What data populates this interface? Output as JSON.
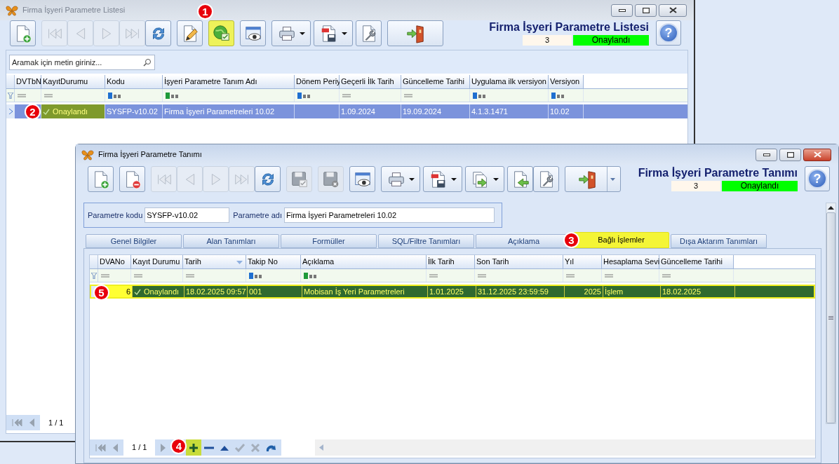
{
  "list_window": {
    "title": "Firma İşyeri Parametre Listesi",
    "toolbar": [
      {
        "kind": "new",
        "disabled": false,
        "highlighted": false
      },
      {
        "kind": "first",
        "disabled": true,
        "highlighted": false
      },
      {
        "kind": "prev",
        "disabled": true,
        "highlighted": false
      },
      {
        "kind": "next",
        "disabled": true,
        "highlighted": false
      },
      {
        "kind": "last",
        "disabled": true,
        "highlighted": false
      },
      {
        "kind": "refresh",
        "disabled": false,
        "highlighted": false
      },
      {
        "kind": "edit",
        "disabled": false,
        "highlighted": false
      },
      {
        "kind": "approve",
        "disabled": false,
        "highlighted": true,
        "marker": "1"
      },
      {
        "kind": "preview",
        "disabled": false,
        "highlighted": false
      },
      {
        "kind": "print",
        "disabled": false,
        "highlighted": false,
        "dropdown": true
      },
      {
        "kind": "pdf",
        "disabled": false,
        "highlighted": false,
        "dropdown": true
      },
      {
        "kind": "settings",
        "disabled": false,
        "highlighted": false
      },
      {
        "kind": "exit",
        "disabled": false,
        "highlighted": false
      }
    ],
    "header_title": "Firma İşyeri Parametre Listesi",
    "count": "3",
    "status": "Onaylandı",
    "help": "?",
    "search": {
      "placeholder": "Aramak için metin giriniz..."
    },
    "columns": [
      "DVTbN",
      "KayıtDurumu",
      "Kodu",
      "İşyeri Parametre Tanım Adı",
      "Dönem Periy",
      "Geçerli İlk Tarih",
      "Güncelleme Tarihi",
      "Uygulama ilk versiyon",
      "Versiyon"
    ],
    "filters": [
      {
        "kind": "eq"
      },
      {
        "kind": "eq"
      },
      {
        "kind": "abc"
      },
      {
        "kind": "abc_green"
      },
      {
        "kind": "abc"
      },
      {
        "kind": "eq"
      },
      {
        "kind": "eq"
      },
      {
        "kind": "abc"
      },
      {
        "kind": "abc"
      }
    ],
    "rows": [
      {
        "selected": true,
        "marker": "2",
        "cells": [
          null,
          {
            "text": "Onaylandı",
            "kind": "status",
            "highlighted": true
          },
          {
            "text": "SYSFP-v10.02"
          },
          {
            "text": "Firma İşyeri Parametreleri 10.02"
          },
          null,
          {
            "text": "1.09.2024"
          },
          {
            "text": "19.09.2024"
          },
          {
            "text": "4.1.3.1471"
          },
          {
            "text": "10.02"
          }
        ]
      }
    ],
    "pager": "1 / 1"
  },
  "detail_window": {
    "title": "Firma İşyeri Parametre Tanımı",
    "toolbar": [
      {
        "kind": "new",
        "disabled": false,
        "highlighted": false
      },
      {
        "kind": "delete",
        "disabled": false,
        "highlighted": false
      },
      {
        "kind": "first",
        "disabled": true,
        "highlighted": false
      },
      {
        "kind": "prev",
        "disabled": true,
        "highlighted": false
      },
      {
        "kind": "next",
        "disabled": true,
        "highlighted": false
      },
      {
        "kind": "last",
        "disabled": true,
        "highlighted": false
      },
      {
        "kind": "refresh",
        "disabled": false,
        "highlighted": false
      },
      {
        "kind": "save",
        "disabled": true,
        "highlighted": false
      },
      {
        "kind": "cancel_save",
        "disabled": true,
        "highlighted": false
      },
      {
        "kind": "preview",
        "disabled": false,
        "highlighted": false
      },
      {
        "kind": "print",
        "disabled": false,
        "highlighted": false,
        "dropdown": true
      },
      {
        "kind": "pdf",
        "disabled": false,
        "highlighted": false,
        "dropdown": true
      },
      {
        "kind": "export",
        "disabled": false,
        "highlighted": false,
        "dropdown": true
      },
      {
        "kind": "import",
        "disabled": false,
        "highlighted": false
      },
      {
        "kind": "settings",
        "disabled": false,
        "highlighted": false
      },
      {
        "kind": "exit",
        "disabled": false,
        "highlighted": false,
        "dropdown": true
      }
    ],
    "header_title": "Firma İşyeri Parametre Tanımı",
    "count": "3",
    "status": "Onaylandı",
    "help": "?",
    "fields": [
      {
        "label": "Parametre kodu",
        "value": "SYSFP-v10.02"
      },
      {
        "label": "Parametre adı",
        "value": "Firma İşyeri Parametreleri 10.02"
      }
    ],
    "tabs": [
      {
        "label": "Genel Bilgiler",
        "selected": false
      },
      {
        "label": "Alan Tanımları",
        "selected": false
      },
      {
        "label": "Formüller",
        "selected": false
      },
      {
        "label": "SQL/Filtre Tanımları",
        "selected": false
      },
      {
        "label": "Açıklama",
        "selected": false
      },
      {
        "label": "Bağlı İşlemler",
        "selected": true,
        "marker": "3"
      },
      {
        "label": "Dışa Aktarım Tanımları",
        "selected": false
      }
    ],
    "columns": [
      {
        "label": "DVANo",
        "sorted": false,
        "numeric": true
      },
      {
        "label": "Kayıt Durumu",
        "sorted": false,
        "numeric": false
      },
      {
        "label": "Tarih",
        "sorted": true,
        "numeric": false
      },
      {
        "label": "Takip No",
        "sorted": false,
        "numeric": false
      },
      {
        "label": "Açıklama",
        "sorted": false,
        "numeric": false
      },
      {
        "label": "İlk Tarih",
        "sorted": false,
        "numeric": false
      },
      {
        "label": "Son Tarih",
        "sorted": false,
        "numeric": false
      },
      {
        "label": "Yıl",
        "sorted": false,
        "numeric": true
      },
      {
        "label": "Hesaplama Sevi",
        "sorted": false,
        "numeric": false
      },
      {
        "label": "Güncelleme Tarihi",
        "sorted": false,
        "numeric": false
      }
    ],
    "filters": [
      {
        "kind": "eq"
      },
      {
        "kind": "eq"
      },
      {
        "kind": "eq"
      },
      {
        "kind": "abc"
      },
      {
        "kind": "abc_green"
      },
      {
        "kind": "eq"
      },
      {
        "kind": "eq"
      },
      {
        "kind": "eq"
      },
      {
        "kind": "eq"
      },
      {
        "kind": "eq"
      }
    ],
    "rows": [
      {
        "selected": true,
        "marker": "5",
        "cells": [
          {
            "text": "6",
            "highlighted": true
          },
          {
            "text": "Onaylandı",
            "kind": "status"
          },
          {
            "text": "18.02.2025 09:57"
          },
          {
            "text": "001"
          },
          {
            "text": "Mobisan İş Yeri Parametreleri"
          },
          {
            "text": "1.01.2025"
          },
          {
            "text": "31.12.2025 23:59:59"
          },
          {
            "text": "2025"
          },
          {
            "text": "İşlem"
          },
          {
            "text": "18.02.2025"
          }
        ]
      }
    ],
    "pager": "1 / 1",
    "nav": [
      {
        "kind": "first",
        "disabled": true,
        "highlighted": false
      },
      {
        "kind": "prev",
        "disabled": true,
        "highlighted": false
      },
      {
        "kind": "pager"
      },
      {
        "kind": "next",
        "disabled": true,
        "highlighted": false
      },
      {
        "kind": "add",
        "disabled": false,
        "highlighted": true,
        "marker": "4"
      },
      {
        "kind": "remove",
        "disabled": false,
        "highlighted": false
      },
      {
        "kind": "up",
        "disabled": false,
        "highlighted": false
      },
      {
        "kind": "check",
        "disabled": true,
        "highlighted": false
      },
      {
        "kind": "cancel",
        "disabled": true,
        "highlighted": false
      },
      {
        "kind": "redo",
        "disabled": false,
        "highlighted": false
      }
    ]
  }
}
